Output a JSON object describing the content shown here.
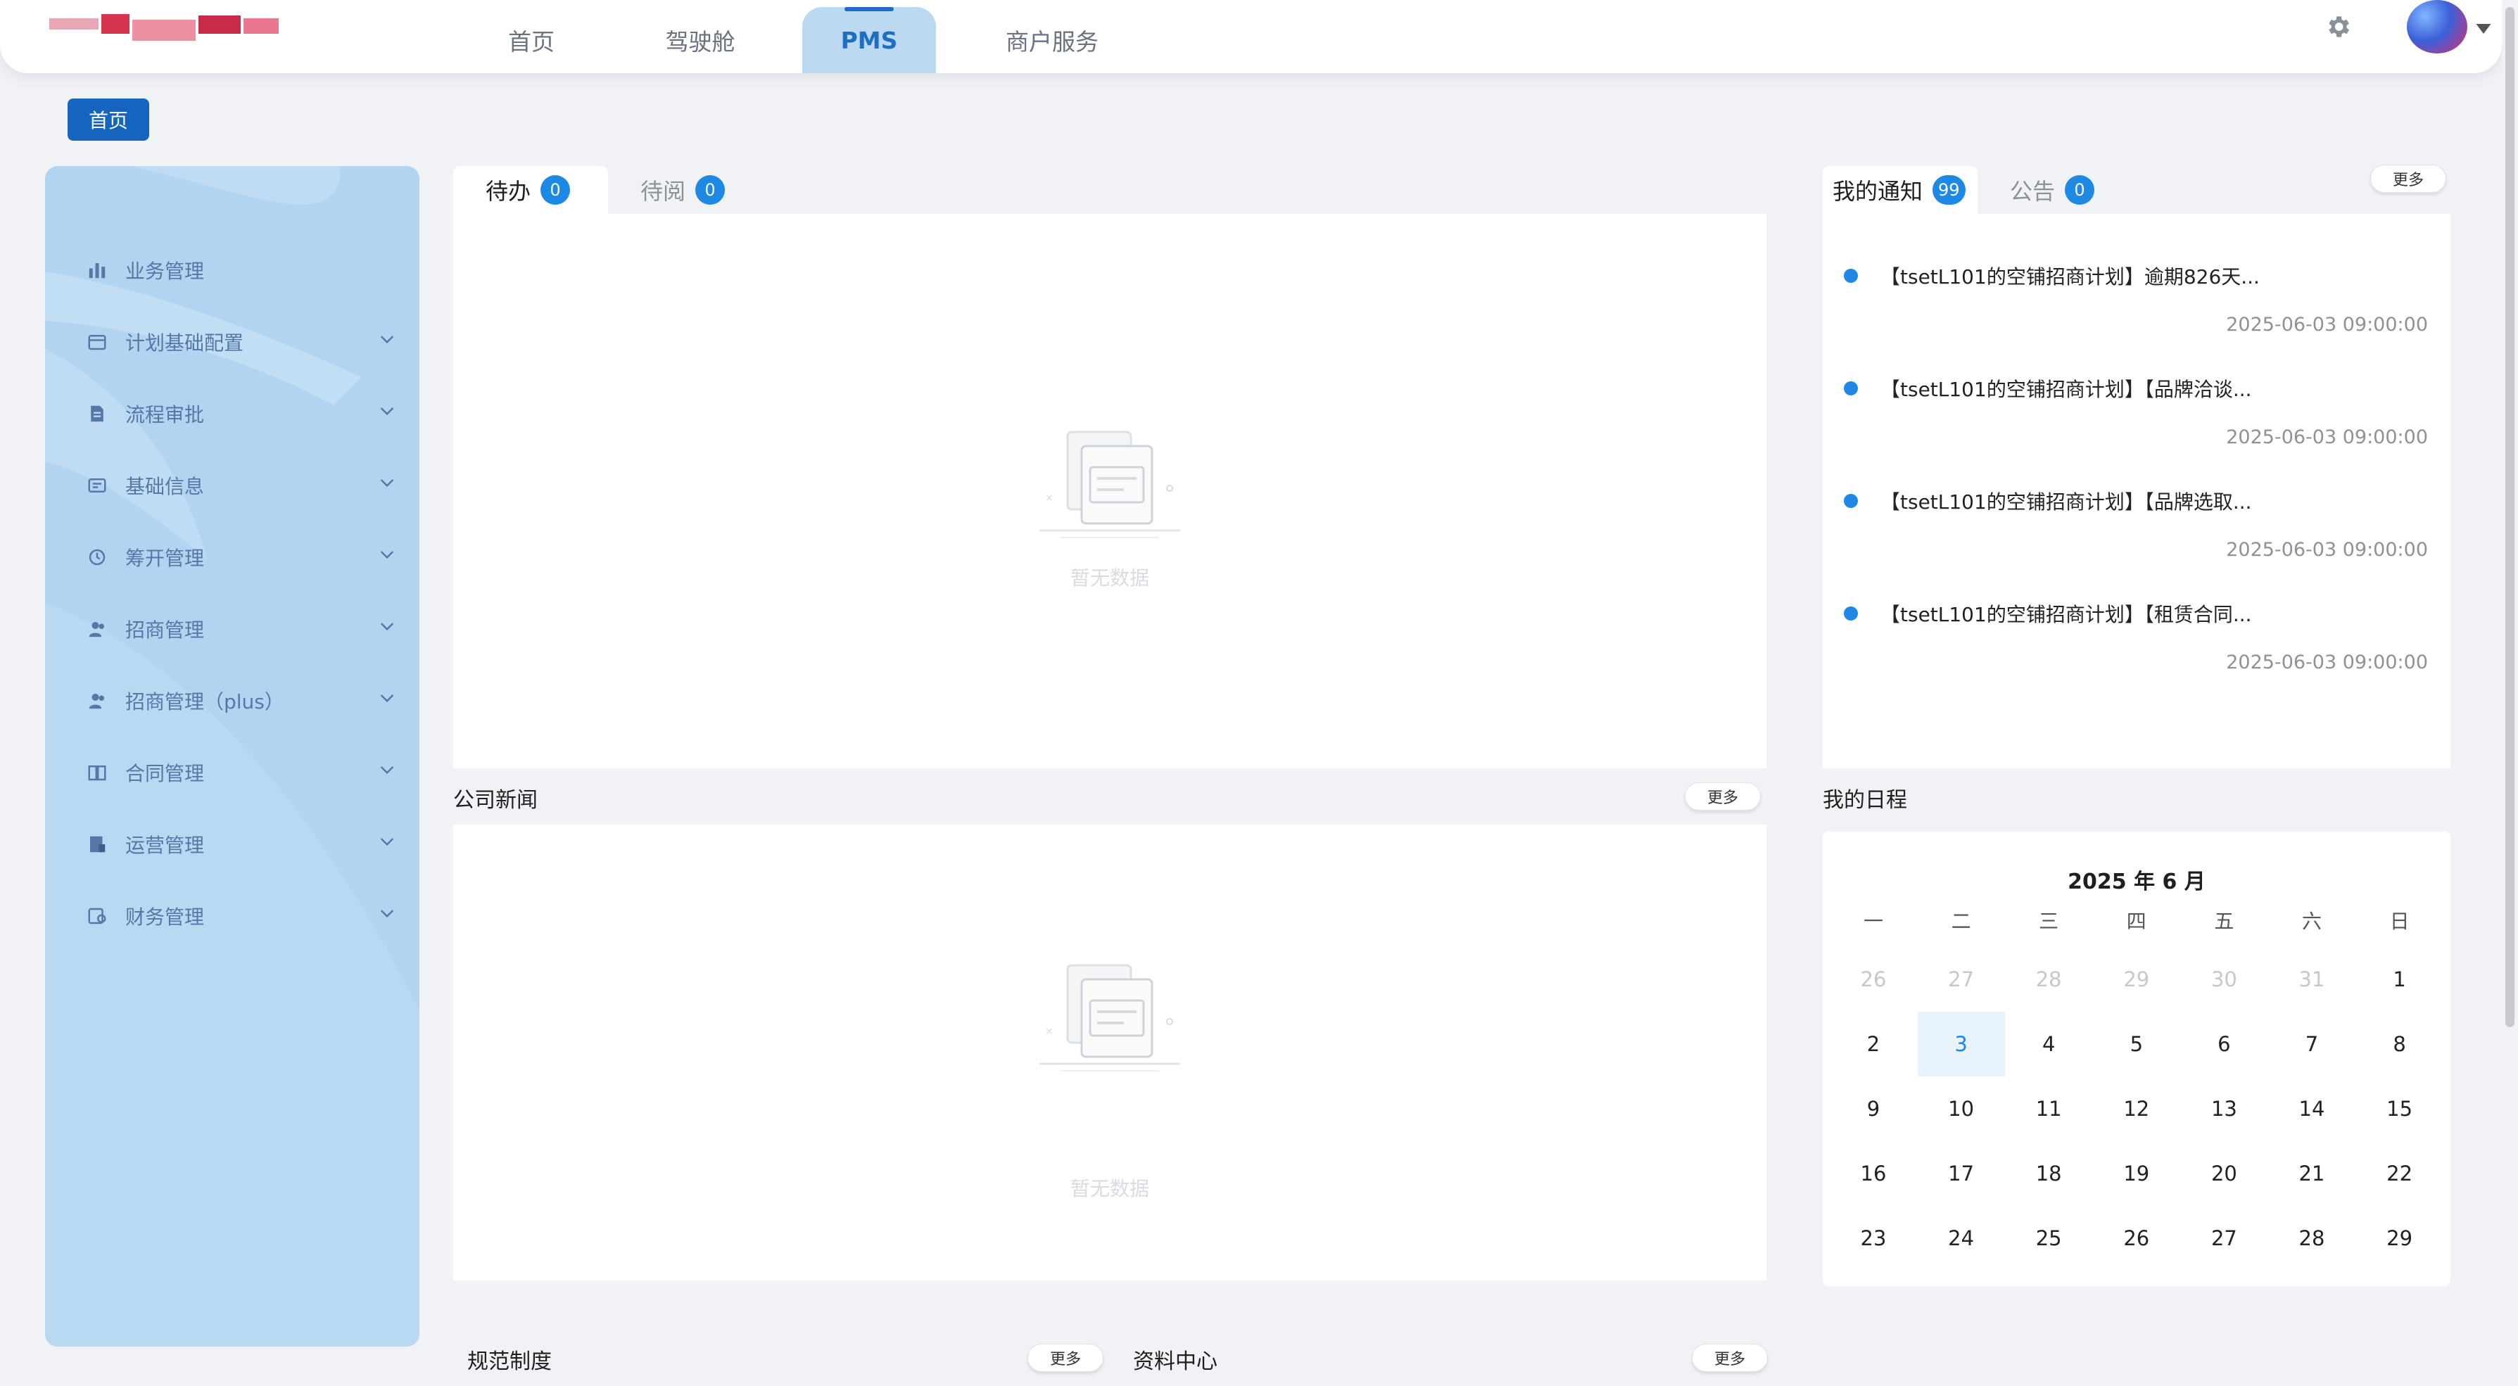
{
  "header": {
    "nav_tabs": [
      {
        "label": "首页"
      },
      {
        "label": "驾驶舱"
      },
      {
        "label": "PMS"
      },
      {
        "label": "商户服务"
      }
    ],
    "active_tab": "PMS"
  },
  "breadcrumb": {
    "label": "首页"
  },
  "sidebar": {
    "items": [
      {
        "label": "业务管理",
        "icon": "bar-chart-icon",
        "has_submenu": false
      },
      {
        "label": "计划基础配置",
        "icon": "calendar-icon",
        "has_submenu": true
      },
      {
        "label": "流程审批",
        "icon": "document-icon",
        "has_submenu": true
      },
      {
        "label": "基础信息",
        "icon": "id-card-icon",
        "has_submenu": true
      },
      {
        "label": "筹开管理",
        "icon": "clock-circle-icon",
        "has_submenu": true
      },
      {
        "label": "招商管理",
        "icon": "users-icon",
        "has_submenu": true
      },
      {
        "label": "招商管理（plus）",
        "icon": "users-icon",
        "has_submenu": true
      },
      {
        "label": "合同管理",
        "icon": "book-icon",
        "has_submenu": true
      },
      {
        "label": "运营管理",
        "icon": "clipboard-icon",
        "has_submenu": true
      },
      {
        "label": "财务管理",
        "icon": "wallet-icon",
        "has_submenu": true
      }
    ]
  },
  "tasks": {
    "tabs": [
      {
        "label": "待办",
        "count": "0"
      },
      {
        "label": "待阅",
        "count": "0"
      }
    ],
    "empty_text": "暂无数据"
  },
  "news": {
    "title": "公司新闻",
    "more_label": "更多",
    "empty_text": "暂无数据"
  },
  "notices": {
    "tabs": [
      {
        "label": "我的通知",
        "count": "99"
      },
      {
        "label": "公告",
        "count": "0"
      }
    ],
    "more_label": "更多",
    "items": [
      {
        "title": "【tsetL101的空铺招商计划】逾期826天...",
        "time": "2025-06-03 09:00:00"
      },
      {
        "title": "【tsetL101的空铺招商计划】【品牌洽谈...",
        "time": "2025-06-03 09:00:00"
      },
      {
        "title": "【tsetL101的空铺招商计划】【品牌选取...",
        "time": "2025-06-03 09:00:00"
      },
      {
        "title": "【tsetL101的空铺招商计划】【租赁合同...",
        "time": "2025-06-03 09:00:00"
      }
    ]
  },
  "schedule": {
    "title": "我的日程",
    "month_title": "2025 年 6 月",
    "weekdays": [
      "一",
      "二",
      "三",
      "四",
      "五",
      "六",
      "日"
    ],
    "weeks": [
      [
        "26",
        "27",
        "28",
        "29",
        "30",
        "31",
        "1"
      ],
      [
        "2",
        "3",
        "4",
        "5",
        "6",
        "7",
        "8"
      ],
      [
        "9",
        "10",
        "11",
        "12",
        "13",
        "14",
        "15"
      ],
      [
        "16",
        "17",
        "18",
        "19",
        "20",
        "21",
        "22"
      ],
      [
        "23",
        "24",
        "25",
        "26",
        "27",
        "28",
        "29"
      ]
    ],
    "muted_first_week_count": 6,
    "today": "3"
  },
  "rules": {
    "title": "规范制度",
    "more_label": "更多"
  },
  "resources": {
    "title": "资料中心",
    "more_label": "更多"
  },
  "colors": {
    "accent": "#1e88e5",
    "active_nav_bg": "#bcd9f2",
    "sidebar_bg": "#b3d4f0",
    "crumb_bg": "#1565c0"
  }
}
